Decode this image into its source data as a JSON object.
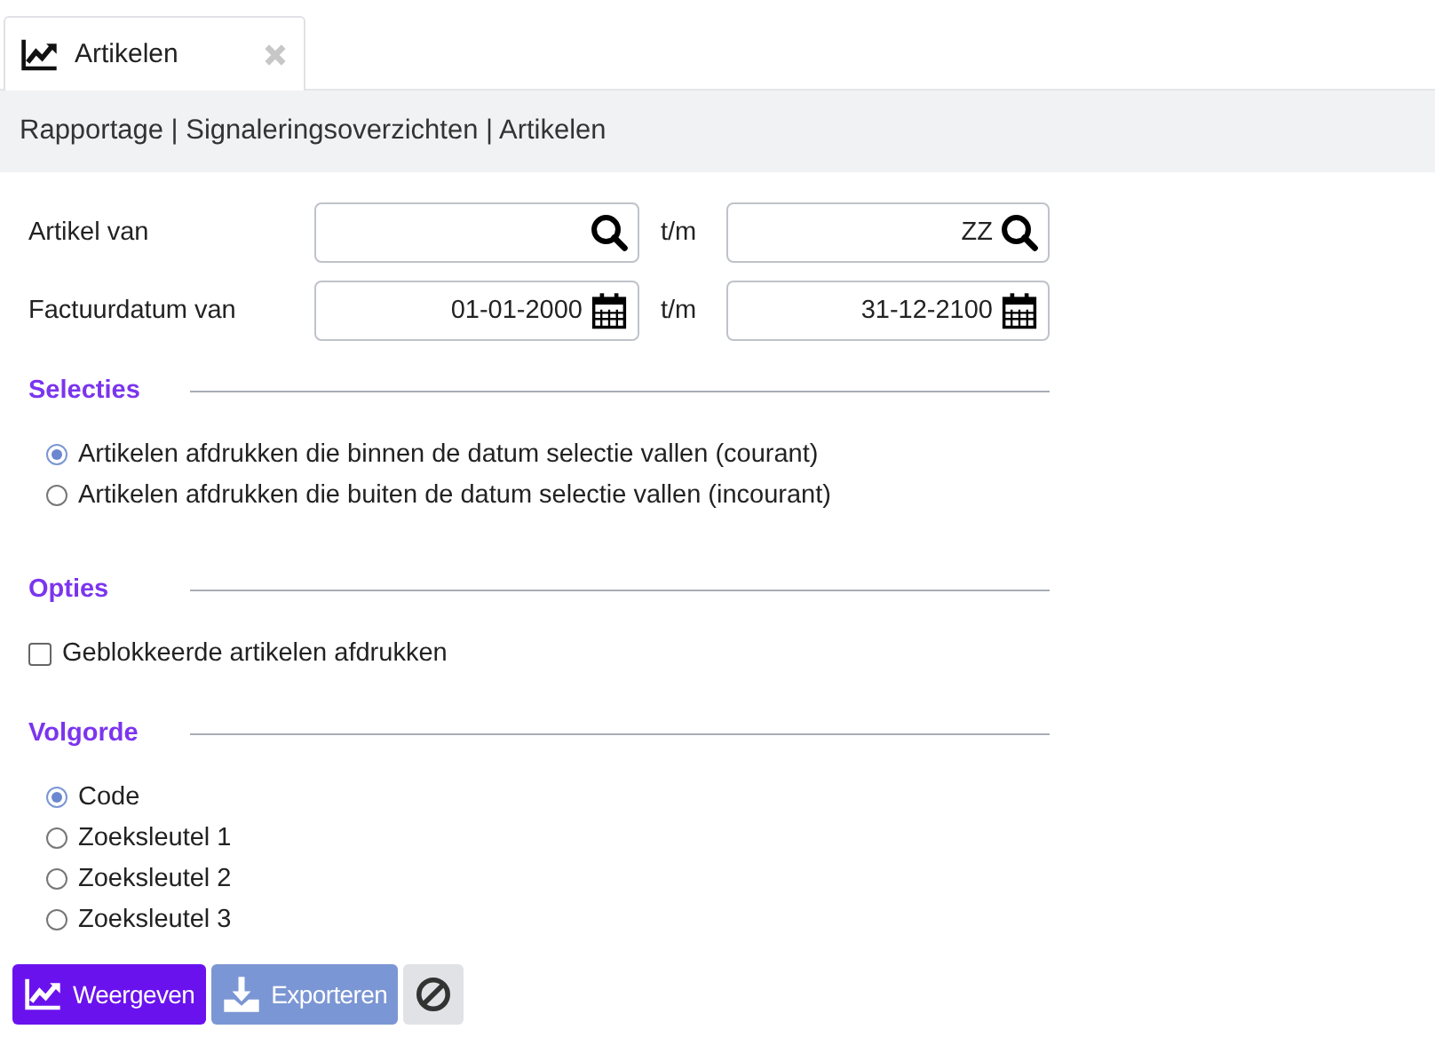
{
  "tabs": [
    {
      "label": "Artikelen",
      "selected": true
    }
  ],
  "breadcrumb": "Rapportage | Signaleringsoverzichten | Artikelen",
  "filters": [
    {
      "label": "Artikel van",
      "kind": "lookup",
      "separator": "t/m",
      "to": {
        "value": "ZZ"
      }
    },
    {
      "label": "Factuurdatum van",
      "kind": "date",
      "separator": "t/m",
      "from": {
        "value": "01-01-2000"
      },
      "to": {
        "value": "31-12-2100"
      }
    }
  ],
  "sections": [
    {
      "title": "Selecties",
      "kind": "radio",
      "options": [
        {
          "label": "Artikelen afdrukken die binnen de datum selectie vallen (courant)",
          "selected": true
        },
        {
          "label": "Artikelen afdrukken die buiten de datum selectie vallen (incourant)",
          "selected": false
        }
      ]
    },
    {
      "title": "Opties",
      "kind": "checkbox",
      "options": [
        {
          "label": "Geblokkeerde artikelen afdrukken",
          "checked": false
        }
      ]
    },
    {
      "title": "Volgorde",
      "kind": "radio",
      "options": [
        {
          "label": "Code",
          "selected": true
        },
        {
          "label": "Zoeksleutel 1",
          "selected": false
        },
        {
          "label": "Zoeksleutel 2",
          "selected": false
        },
        {
          "label": "Zoeksleutel 3",
          "selected": false
        }
      ]
    }
  ],
  "buttons": [
    {
      "label": "Weergeven",
      "kind": "show",
      "disabled": false
    },
    {
      "label": "Exporteren",
      "kind": "export",
      "disabled": true
    },
    {
      "kind": "cancel",
      "disabled": false
    }
  ]
}
